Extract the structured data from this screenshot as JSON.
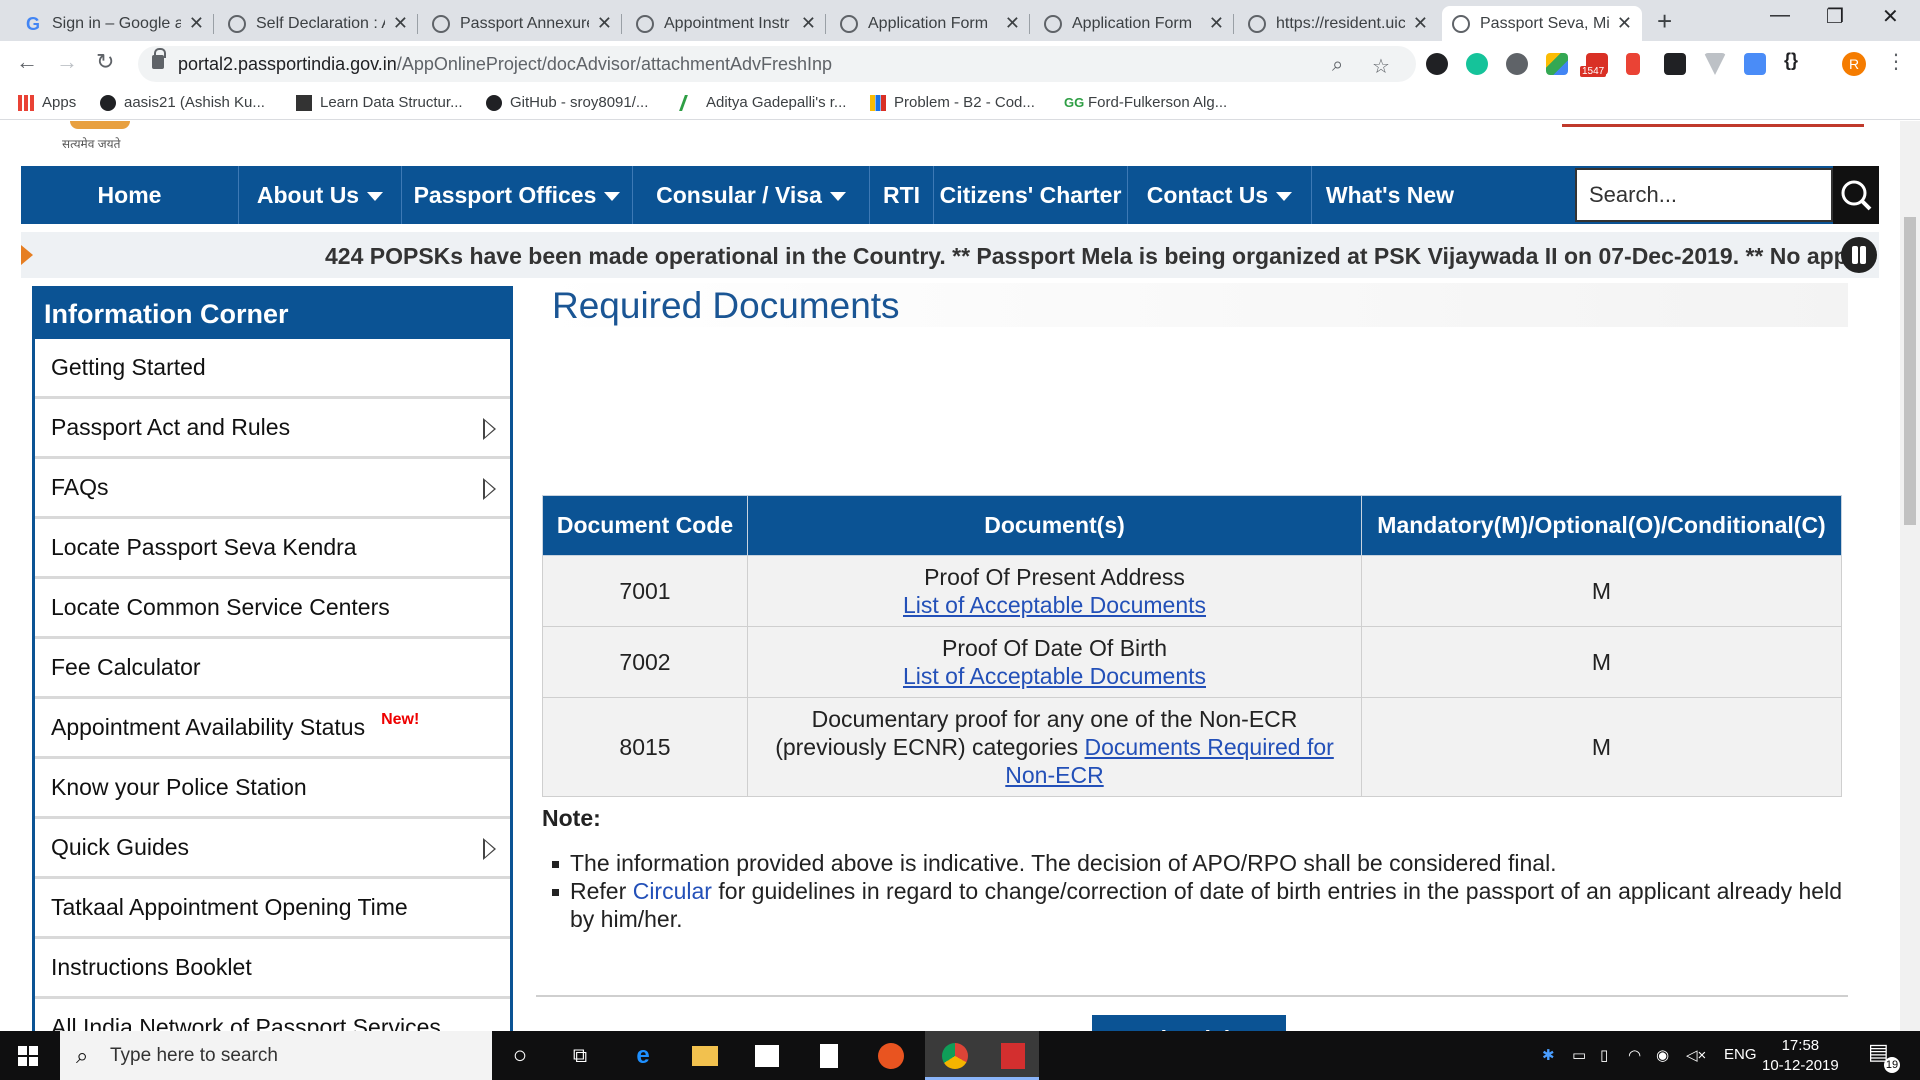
{
  "browser": {
    "tabs": [
      {
        "title": "Sign in – Google a"
      },
      {
        "title": "Self Declaration : A"
      },
      {
        "title": "Passport Annexure"
      },
      {
        "title": "Appointment Instr"
      },
      {
        "title": "Application Form"
      },
      {
        "title": "Application Form"
      },
      {
        "title": "https://resident.uic"
      },
      {
        "title": "Passport Seva, Min"
      }
    ],
    "url_host": "portal2.passportindia.gov.in",
    "url_path": "/AppOnlineProject/docAdvisor/attachmentAdvFreshInp",
    "profile_initial": "R",
    "extension_badge": "1547",
    "bookmarks": [
      {
        "label": "Apps"
      },
      {
        "label": "aasis21 (Ashish Ku..."
      },
      {
        "label": "Learn Data Structur..."
      },
      {
        "label": "GitHub - sroy8091/..."
      },
      {
        "label": "Aditya Gadepalli's r..."
      },
      {
        "label": "Problem - B2 - Cod..."
      },
      {
        "label": "Ford-Fulkerson Alg..."
      }
    ]
  },
  "site": {
    "emblem_text": "सत्यमेव जयते",
    "nav": {
      "home": "Home",
      "about": "About Us",
      "offices": "Passport Offices",
      "consular": "Consular / Visa",
      "rti": "RTI",
      "charter": "Citizens' Charter",
      "contact": "Contact Us",
      "whats_new": "What's New",
      "search_placeholder": "Search..."
    },
    "ticker": "424 POPSKs have been made operational in the Country. ** Passport Mela is being organized at PSK Vijaywada II on 07-Dec-2019. ** No appli",
    "sidebar": {
      "title": "Information Corner",
      "items": [
        {
          "label": "Getting Started"
        },
        {
          "label": "Passport Act and Rules"
        },
        {
          "label": "FAQs"
        },
        {
          "label": "Locate Passport Seva Kendra"
        },
        {
          "label": "Locate Common Service Centers"
        },
        {
          "label": "Fee Calculator"
        },
        {
          "label": "Appointment Availability Status",
          "badge": "New!"
        },
        {
          "label": "Know your Police Station"
        },
        {
          "label": "Quick Guides"
        },
        {
          "label": "Tatkaal Appointment Opening Time"
        },
        {
          "label": "Instructions Booklet"
        },
        {
          "label": "All India Network of Passport Services"
        }
      ]
    },
    "main": {
      "title": "Required Documents",
      "table": {
        "headers": [
          "Document Code",
          "Document(s)",
          "Mandatory(M)/Optional(O)/Conditional(C)"
        ],
        "rows": [
          {
            "code": "7001",
            "doc": "Proof Of Present Address",
            "link": "List of Acceptable Documents",
            "req": "M"
          },
          {
            "code": "7002",
            "doc": "Proof Of Date Of Birth",
            "link": "List of Acceptable Documents",
            "req": "M"
          },
          {
            "code": "8015",
            "doc_line1": "Documentary proof for any one of the Non-ECR",
            "doc_line2": "(previously ECNR) categories",
            "link_part1": "Documents Required for",
            "link_part2": "Non-ECR",
            "req": "M"
          }
        ]
      },
      "note_label": "Note:",
      "notes": [
        {
          "text": "The information provided above is indicative. The decision of APO/RPO shall be considered final."
        },
        {
          "pre": "Refer",
          "link": "Circular",
          "post": "for guidelines in regard to change/correction of date of birth entries in the passport of an applicant already held by him/her."
        }
      ],
      "fresh_button": "Fresh Advisor"
    }
  },
  "taskbar": {
    "search_placeholder": "Type here to search",
    "lang": "ENG",
    "time": "17:58",
    "date": "10-12-2019",
    "notifications": "19"
  }
}
